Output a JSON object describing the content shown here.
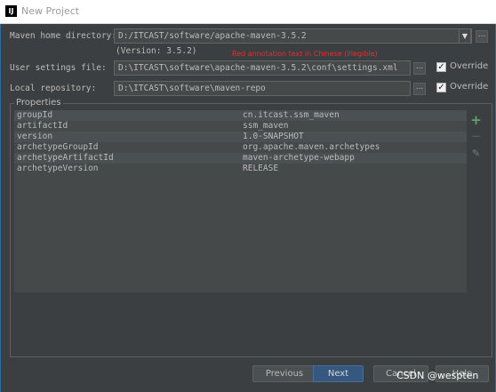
{
  "window": {
    "title": "New Project",
    "app_icon": "IJ"
  },
  "maven_home": {
    "label": "Maven home directory:",
    "value": "D:/ITCAST/software/apache-maven-3.5.2",
    "version": "(Version: 3.5.2)",
    "dropdown_glyph": "▼",
    "browse_glyph": "..."
  },
  "annotation": "Red annotation text in Chinese (illegible)",
  "user_settings": {
    "label": "User settings file:",
    "value": "D:\\ITCAST\\software\\apache-maven-3.5.2\\conf\\settings.xml",
    "browse_glyph": "...",
    "override_label": "Override",
    "override_checked": true
  },
  "local_repo": {
    "label": "Local repository:",
    "value": "D:\\ITCAST\\software\\maven-repo",
    "browse_glyph": "...",
    "override_label": "Override",
    "override_checked": true
  },
  "properties": {
    "title": "Properties",
    "rows": [
      {
        "key": "groupId",
        "value": "cn.itcast.ssm_maven"
      },
      {
        "key": "artifactId",
        "value": "ssm_maven"
      },
      {
        "key": "version",
        "value": "1.0-SNAPSHOT"
      },
      {
        "key": "archetypeGroupId",
        "value": "org.apache.maven.archetypes"
      },
      {
        "key": "archetypeArtifactId",
        "value": "maven-archetype-webapp"
      },
      {
        "key": "archetypeVersion",
        "value": "RELEASE"
      }
    ],
    "tools": {
      "add": "+",
      "remove": "—",
      "edit": "✎"
    }
  },
  "buttons": {
    "previous": "Previous",
    "next": "Next",
    "cancel": "Cancel",
    "help": "Help"
  },
  "watermark": "CSDN @wespten",
  "colors": {
    "background": "#3c3f41",
    "field": "#45494a",
    "primary_button": "#365880",
    "add_icon": "#59a869",
    "annotation": "#e82c2c"
  }
}
